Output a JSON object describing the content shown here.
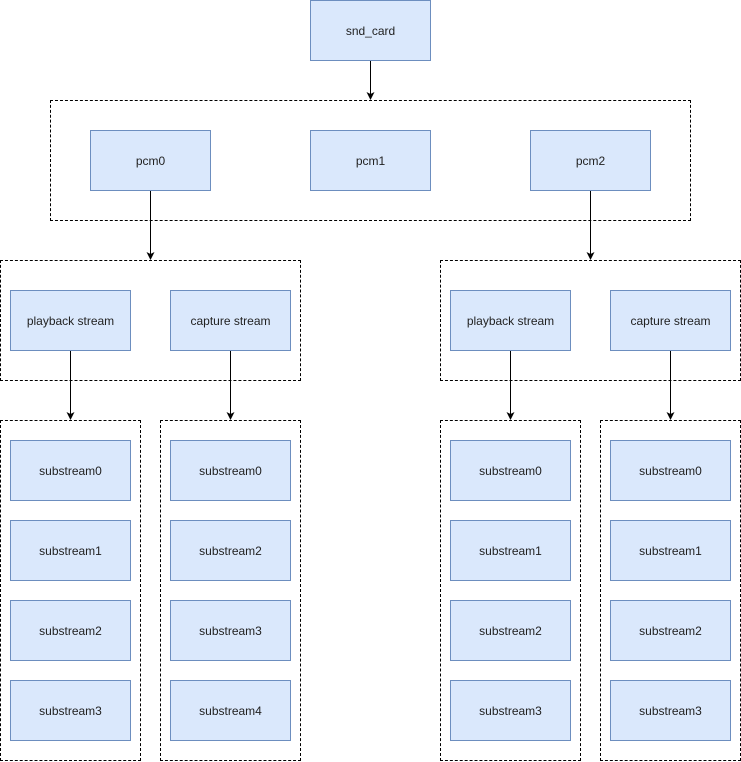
{
  "diagram": {
    "root": {
      "label": "snd_card"
    },
    "pcms": [
      {
        "label": "pcm0"
      },
      {
        "label": "pcm1"
      },
      {
        "label": "pcm2"
      }
    ],
    "stream_groups": [
      {
        "parent": "pcm0",
        "streams": [
          {
            "label": "playback stream",
            "substreams": [
              "substream0",
              "substream1",
              "substream2",
              "substream3"
            ]
          },
          {
            "label": "capture stream",
            "substreams": [
              "substream0",
              "substream2",
              "substream3",
              "substream4"
            ]
          }
        ]
      },
      {
        "parent": "pcm2",
        "streams": [
          {
            "label": "playback stream",
            "substreams": [
              "substream0",
              "substream1",
              "substream2",
              "substream3"
            ]
          },
          {
            "label": "capture stream",
            "substreams": [
              "substream0",
              "substream1",
              "substream2",
              "substream3"
            ]
          }
        ]
      }
    ],
    "colors": {
      "node_fill": "#dae8fc",
      "node_stroke": "#6c8ebf",
      "edge": "#000000"
    }
  }
}
